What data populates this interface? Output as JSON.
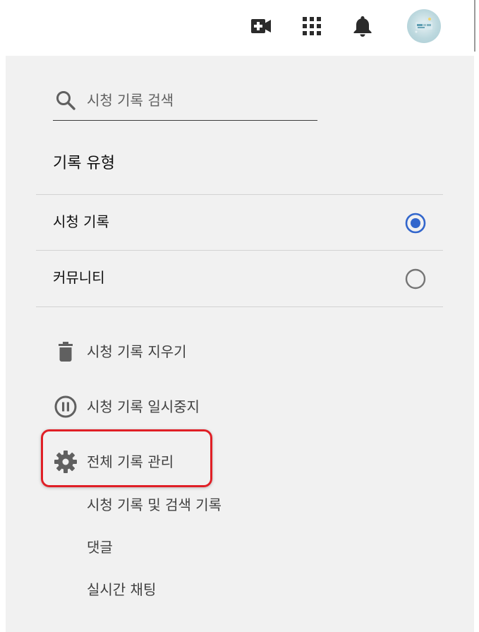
{
  "header": {
    "create_icon": "video-create-icon",
    "apps_icon": "apps-grid-icon",
    "notifications_icon": "bell-icon",
    "avatar_icon": "avatar"
  },
  "sidebar": {
    "search": {
      "placeholder": "시청 기록 검색",
      "value": ""
    },
    "history_type_title": "기록 유형",
    "history_types": [
      {
        "label": "시청 기록",
        "selected": true
      },
      {
        "label": "커뮤니티",
        "selected": false
      }
    ],
    "actions": [
      {
        "label": "시청 기록 지우기",
        "icon": "trash-icon"
      },
      {
        "label": "시청 기록 일시중지",
        "icon": "pause-circle-icon"
      },
      {
        "label": "전체 기록 관리",
        "icon": "gear-icon",
        "highlighted": true
      }
    ],
    "sub_links": [
      {
        "label": "시청 기록 및 검색 기록"
      },
      {
        "label": "댓글"
      },
      {
        "label": "실시간 채팅"
      }
    ]
  },
  "colors": {
    "accent_blue": "#3266cc",
    "highlight_red": "#e01f26",
    "panel_bg": "#f1f1f1"
  }
}
